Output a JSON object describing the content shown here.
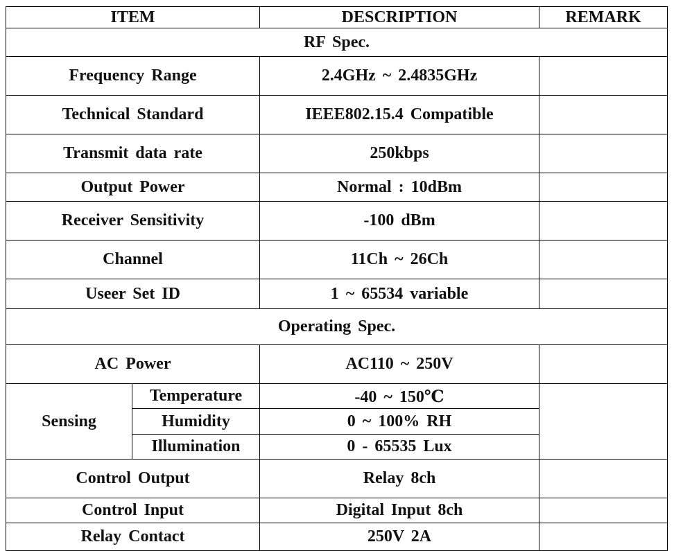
{
  "header": {
    "item": "ITEM",
    "description": "DESCRIPTION",
    "remark": "REMARK"
  },
  "sections": {
    "rf": "RF Spec.",
    "operating": "Operating Spec."
  },
  "rf_rows": [
    {
      "item": "Frequency Range",
      "description": "2.4GHz ~ 2.4835GHz",
      "remark": ""
    },
    {
      "item": "Technical Standard",
      "description": "IEEE802.15.4 Compatible",
      "remark": ""
    },
    {
      "item": "Transmit data rate",
      "description": "250kbps",
      "remark": ""
    },
    {
      "item": "Output Power",
      "description": "Normal : 10dBm",
      "remark": ""
    },
    {
      "item": "Receiver Sensitivity",
      "description": "-100 dBm",
      "remark": ""
    },
    {
      "item": "Channel",
      "description": "11Ch ~ 26Ch",
      "remark": ""
    },
    {
      "item": "Useer Set ID",
      "description": "1 ~ 65534 variable",
      "remark": ""
    }
  ],
  "operating_rows": {
    "ac_power": {
      "item": "AC Power",
      "description": "AC110 ~ 250V",
      "remark": ""
    },
    "sensing": {
      "item": "Sensing",
      "sub": [
        {
          "item": "Temperature",
          "description": "-40 ~ 150℃"
        },
        {
          "item": "Humidity",
          "description": "0 ~ 100% RH"
        },
        {
          "item": "Illumination",
          "description": "0 - 65535 Lux"
        }
      ],
      "remark": ""
    },
    "control_output": {
      "item": "Control Output",
      "description": "Relay 8ch",
      "remark": ""
    },
    "control_input": {
      "item": "Control Input",
      "description": "Digital Input 8ch",
      "remark": ""
    },
    "relay_contact": {
      "item": "Relay Contact",
      "description": "250V 2A",
      "remark": ""
    }
  }
}
